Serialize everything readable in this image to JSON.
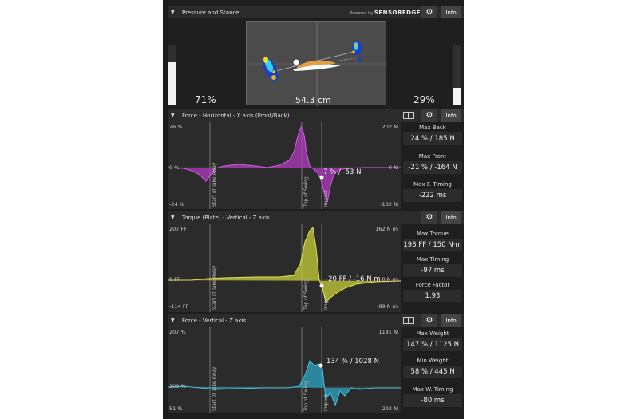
{
  "pressure": {
    "title": "Pressure and Stance",
    "powered_by": "Powered by",
    "brand": "SENSOREDGE",
    "info": "Info",
    "left_pct": "71%",
    "right_pct": "29%",
    "distance": "54.3 cm",
    "left_gauge_fraction": 0.71,
    "right_gauge_fraction": 0.29
  },
  "force_x": {
    "title": "Force - Horizontal - X axis (Front/Back)",
    "info": "Info",
    "y_top_left": "26 %",
    "y_top_right": "202 N",
    "y_zero_left": "0 %",
    "y_zero_right": "0 N",
    "y_bot_left": "-24 %",
    "y_bot_right": "-182 N",
    "callout": "-7 % / -53 N",
    "marks": [
      "Start of Take Away",
      "Top of Swing",
      "Impact"
    ],
    "stats": [
      {
        "title": "Max Back",
        "value": "24 % / 185 N"
      },
      {
        "title": "Max Front",
        "value": "-21 % / -164 N"
      },
      {
        "title": "Max F. Timing",
        "value": "-222 ms"
      }
    ]
  },
  "torque": {
    "title": "Torque (Plate) - Vertical - Z axis",
    "info": "Info",
    "y_top_left": "207 FF",
    "y_top_right": "162 N m",
    "y_zero_left": "0 FF",
    "y_zero_right": "0 N m",
    "y_bot_left": "-114 FF",
    "y_bot_right": "-89 N m",
    "callout": "-20 FF / -16 N m",
    "marks": [
      "Start of Take Away",
      "Top of Swing",
      "Impact"
    ],
    "stats": [
      {
        "title": "Max Torque",
        "value": "193 FF / 150 N·m"
      },
      {
        "title": "Max Timing",
        "value": "-97 ms"
      },
      {
        "title": "Force Factor",
        "value": "1.93"
      }
    ]
  },
  "force_z": {
    "title": "Force - Vertical - Z axis",
    "info": "Info",
    "y_top_left": "207 %",
    "y_top_right": "1181 N",
    "y_mid_left": "100 %",
    "y_bot_left": "51 %",
    "y_bot_right": "292 N",
    "callout": "134 % / 1028 N",
    "marks": [
      "Start of Take Away",
      "Top of Swing",
      "Impact"
    ],
    "stats": [
      {
        "title": "Max Weight",
        "value": "147 % / 1125 N"
      },
      {
        "title": "Min Weight",
        "value": "58 % / 445 N"
      },
      {
        "title": "Max W. Timing",
        "value": "-80 ms"
      }
    ]
  },
  "colors": {
    "force_x": "#b23bbf",
    "torque": "#c8cf38",
    "force_z": "#2ea6c4"
  }
}
